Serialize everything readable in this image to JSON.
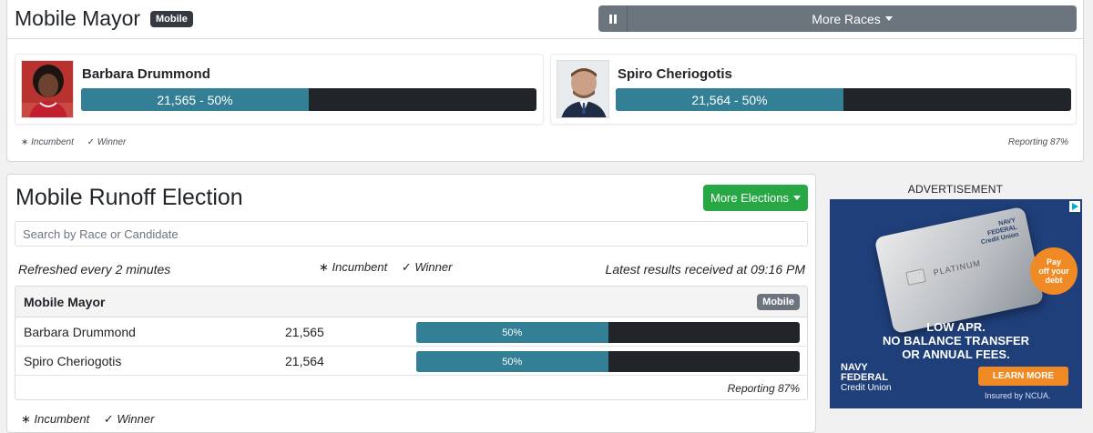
{
  "top": {
    "race_title": "Mobile Mayor",
    "badge": "Mobile",
    "more_races_label": "More Races",
    "candidates": [
      {
        "name": "Barbara Drummond",
        "votes_label": "21,565 - 50%",
        "share": 0.5
      },
      {
        "name": "Spiro Cheriogotis",
        "votes_label": "21,564 - 50%",
        "share": 0.5
      }
    ],
    "legend_incumbent": "∗ Incumbent",
    "legend_winner": "✓ Winner",
    "reporting": "Reporting 87%"
  },
  "main": {
    "title": "Mobile Runoff Election",
    "more_elections_label": "More Elections",
    "search_placeholder": "Search by Race or Candidate",
    "refreshed": "Refreshed every 2 minutes",
    "legend_incumbent": "∗ Incumbent",
    "legend_winner": "✓ Winner",
    "latest": "Latest results received at 09:16 PM",
    "race": {
      "title": "Mobile Mayor",
      "badge": "Mobile",
      "rows": [
        {
          "name": "Barbara Drummond",
          "votes": "21,565",
          "pct": "50%",
          "share": 0.5
        },
        {
          "name": "Spiro Cheriogotis",
          "votes": "21,564",
          "pct": "50%",
          "share": 0.5
        }
      ],
      "reporting": "Reporting 87%"
    }
  },
  "ad": {
    "label": "ADVERTISEMENT",
    "card_text": "PLATINUM",
    "card_logo_line1": "NAVY",
    "card_logo_line2": "FEDERAL",
    "card_logo_line3": "Credit Union",
    "badge_line1": "Pay",
    "badge_line2": "off your",
    "badge_line3": "debt",
    "headline_line1": "LOW APR.",
    "headline_line2": "NO BALANCE TRANSFER",
    "headline_line3": "OR ANNUAL FEES.",
    "logo_line1": "NAVY",
    "logo_line2": "FEDERAL",
    "logo_line3": "Credit Union",
    "cta": "LEARN MORE",
    "insured": "Insured by NCUA."
  },
  "colors": {
    "bar_fill": "#337f96",
    "bar_track": "#212529",
    "green_button": "#28a745",
    "grey_button": "#6c757d",
    "ad_bg": "#1f3f7a",
    "ad_orange": "#f08a24"
  }
}
